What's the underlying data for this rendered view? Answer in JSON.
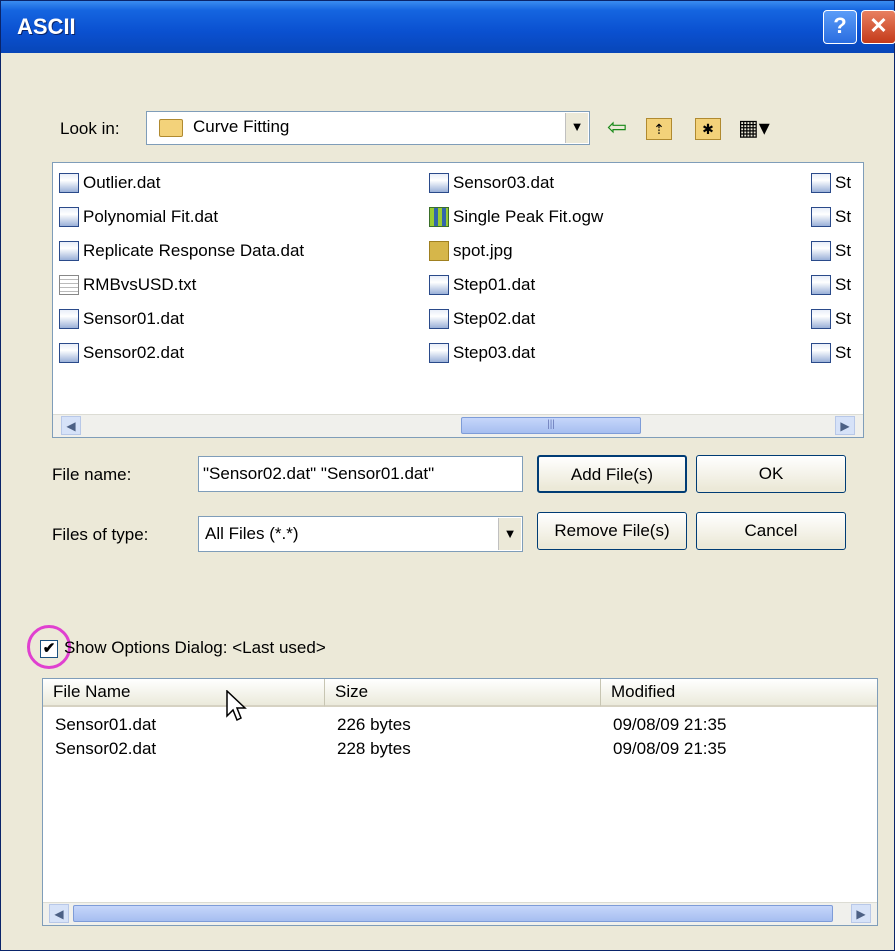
{
  "window": {
    "title": "ASCII"
  },
  "titlebar": {
    "help_glyph": "?",
    "close_glyph": "✕"
  },
  "look_in": {
    "label": "Look in:",
    "value": "Curve Fitting"
  },
  "toolbar": [
    "back-icon",
    "up-folder-icon",
    "new-folder-icon",
    "view-menu-icon"
  ],
  "files": {
    "columns": [
      [
        {
          "name": "Outlier.dat",
          "icon": "dat"
        },
        {
          "name": "Polynomial Fit.dat",
          "icon": "dat"
        },
        {
          "name": "Replicate Response Data.dat",
          "icon": "dat"
        },
        {
          "name": "RMBvsUSD.txt",
          "icon": "txt"
        },
        {
          "name": "Sensor01.dat",
          "icon": "dat"
        },
        {
          "name": "Sensor02.dat",
          "icon": "dat"
        }
      ],
      [
        {
          "name": "Sensor03.dat",
          "icon": "dat"
        },
        {
          "name": "Single Peak Fit.ogw",
          "icon": "ogw"
        },
        {
          "name": "spot.jpg",
          "icon": "jpg"
        },
        {
          "name": "Step01.dat",
          "icon": "dat"
        },
        {
          "name": "Step02.dat",
          "icon": "dat"
        },
        {
          "name": "Step03.dat",
          "icon": "dat"
        }
      ],
      [
        {
          "name": "St",
          "icon": "dat"
        },
        {
          "name": "St",
          "icon": "dat"
        },
        {
          "name": "St",
          "icon": "dat"
        },
        {
          "name": "St",
          "icon": "dat"
        },
        {
          "name": "St",
          "icon": "dat"
        },
        {
          "name": "St",
          "icon": "dat"
        }
      ]
    ]
  },
  "file_name": {
    "label": "File name:",
    "value": "\"Sensor02.dat\" \"Sensor01.dat\""
  },
  "file_type": {
    "label": "Files of type:",
    "value": "All Files (*.*)"
  },
  "buttons": {
    "add": "Add File(s)",
    "ok": "OK",
    "remove": "Remove File(s)",
    "cancel": "Cancel"
  },
  "options": {
    "checked": true,
    "label": "Show Options Dialog: <Last used>"
  },
  "selected": {
    "headers": [
      "File Name",
      "Size",
      "Modified"
    ],
    "rows": [
      [
        "Sensor01.dat",
        "226 bytes",
        "09/08/09 21:35"
      ],
      [
        "Sensor02.dat",
        "228 bytes",
        "09/08/09 21:35"
      ]
    ]
  }
}
